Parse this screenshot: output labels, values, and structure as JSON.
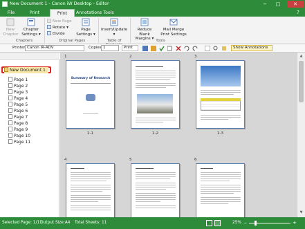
{
  "window": {
    "title": "New Document 1 - Canon iW Desktop - Editor",
    "minimize_glyph": "−",
    "maximize_glyph": "□",
    "close_glyph": "✕"
  },
  "tabs": [
    "File",
    "Print Settings",
    "Print Option",
    "Annotations",
    "Tools"
  ],
  "ribbon": {
    "new_chapter": "New Chapter",
    "chapter_settings": "Chapter Settings ▾",
    "new_page": "New Page",
    "rotate": "Rotate ▾",
    "divide": "Divide",
    "page_settings": "Page Settings ▾",
    "insert_update": "Insert/Update ▾",
    "reduce_margins": "Reduce Blank Margins ▾",
    "mail_merge": "Mail Merge Print Settings",
    "groups": [
      "Chapters",
      "Original Pages",
      "Table of Contents",
      "Tools"
    ]
  },
  "toolbar": {
    "printer_label": "Printer",
    "printer_value": "Canon iR-ADV",
    "copies_label": "Copies",
    "copies_value": "1",
    "print_label": "Print",
    "show_annotations": "Show Annotations"
  },
  "tree": {
    "root": "New Document 1",
    "pages": [
      "Page 1",
      "Page 2",
      "Page 3",
      "Page 4",
      "Page 5",
      "Page 6",
      "Page 7",
      "Page 8",
      "Page 9",
      "Page 10",
      "Page 11"
    ]
  },
  "pages": [
    {
      "number": "1",
      "caption": "1-1",
      "heading": "Summary of Research",
      "kind": "cover"
    },
    {
      "number": "2",
      "caption": "1-2",
      "heading": "",
      "kind": "text-photo"
    },
    {
      "number": "3",
      "caption": "1-3",
      "heading": "",
      "kind": "photo-table"
    },
    {
      "number": "4",
      "caption": "",
      "heading": "",
      "kind": "text"
    },
    {
      "number": "5",
      "caption": "",
      "heading": "",
      "kind": "text"
    },
    {
      "number": "6",
      "caption": "",
      "heading": "",
      "kind": "text"
    }
  ],
  "status": {
    "selected": "Selected Page: 1/11",
    "output_size": "Output Size:A4",
    "total_sheets": "Total Sheets: 11",
    "zoom": "25%"
  }
}
